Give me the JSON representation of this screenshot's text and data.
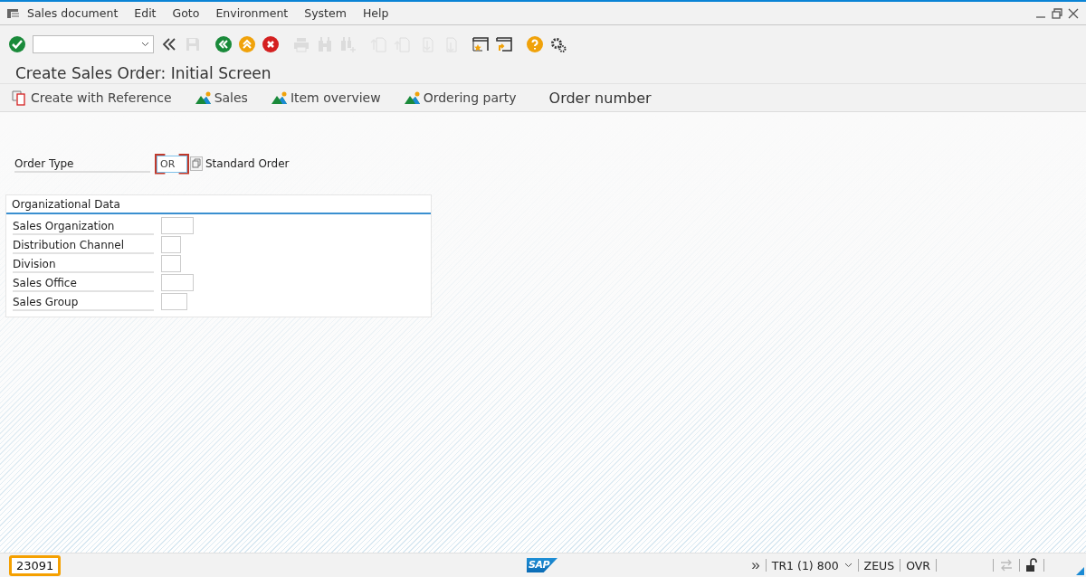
{
  "menu_bar": {
    "items": [
      "Sales document",
      "Edit",
      "Goto",
      "Environment",
      "System",
      "Help"
    ]
  },
  "toolbar": {
    "icons": [
      {
        "kind": "enter",
        "disabled": false
      },
      {
        "kind": "command-field"
      },
      {
        "kind": "collapse",
        "disabled": false
      },
      {
        "kind": "save",
        "disabled": true
      },
      {
        "kind": "back",
        "disabled": false
      },
      {
        "kind": "exit",
        "disabled": false
      },
      {
        "kind": "cancel",
        "disabled": false
      },
      {
        "kind": "print",
        "disabled": true
      },
      {
        "kind": "find",
        "disabled": true
      },
      {
        "kind": "find-next",
        "disabled": true
      },
      {
        "kind": "first-page",
        "disabled": true
      },
      {
        "kind": "prev-page",
        "disabled": true
      },
      {
        "kind": "next-page",
        "disabled": true
      },
      {
        "kind": "last-page",
        "disabled": true
      },
      {
        "kind": "new-session",
        "disabled": false
      },
      {
        "kind": "shortcut",
        "disabled": false
      },
      {
        "kind": "help",
        "disabled": false
      },
      {
        "kind": "settings",
        "disabled": false
      }
    ]
  },
  "screen_title": "Create Sales Order: Initial Screen",
  "app_toolbar": [
    {
      "kind": "reference",
      "label": "Create with Reference"
    },
    {
      "kind": "mountain",
      "label": "Sales"
    },
    {
      "kind": "mountain",
      "label": "Item overview"
    },
    {
      "kind": "mountain",
      "label": "Ordering party"
    },
    {
      "kind": "plain",
      "label": "Order number"
    }
  ],
  "order_type": {
    "label": "Order Type",
    "value": "OR",
    "description": "Standard Order"
  },
  "organizational_data": {
    "title": "Organizational Data",
    "fields": [
      {
        "label": "Sales Organization"
      },
      {
        "label": "Distribution Channel"
      },
      {
        "label": "Division"
      },
      {
        "label": "Sales Office"
      },
      {
        "label": "Sales Group"
      }
    ]
  },
  "status_bar": {
    "message": "23091",
    "logo": "SAP",
    "expand": "»",
    "system": "TR1 (1) 800",
    "server": "ZEUS",
    "mode": "OVR"
  }
}
